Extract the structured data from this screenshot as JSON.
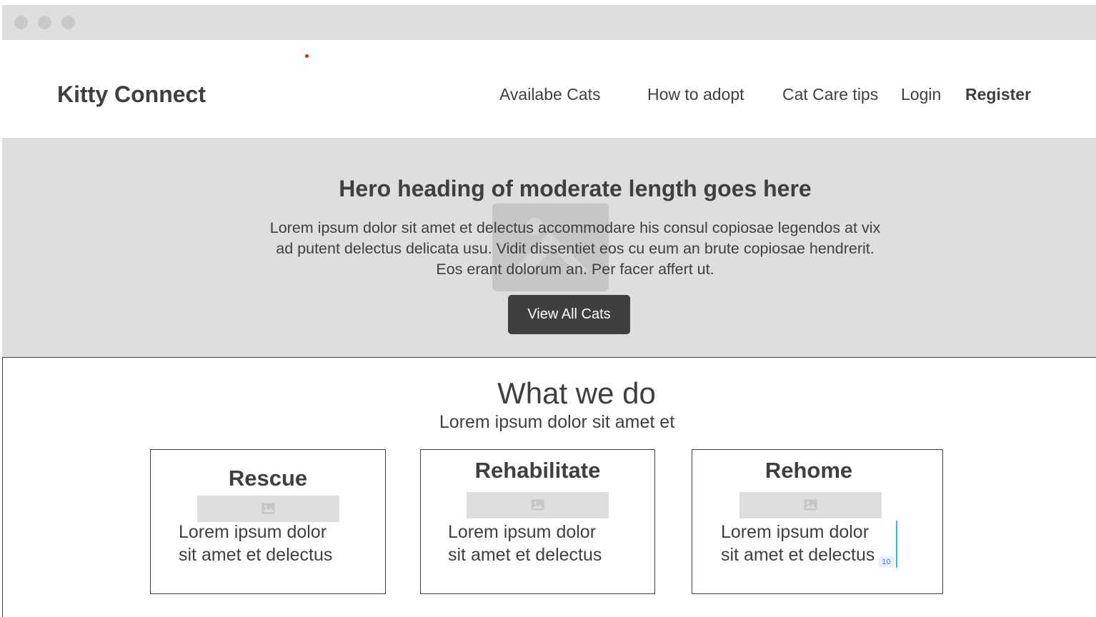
{
  "brand": "Kitty Connect",
  "nav": {
    "available_cats": "Availabe Cats",
    "how_to_adopt": "How to adopt",
    "cat_care_tips": "Cat Care tips",
    "login": "Login",
    "register": "Register"
  },
  "hero": {
    "title": "Hero heading of moderate length goes here",
    "text": "Lorem ipsum dolor sit amet et delectus accommodare his consul copiosae legendos at vix ad putent delectus delicata usu. Vidit dissentiet eos cu eum an brute copiosae hendrerit. Eos erant dolorum an. Per facer affert ut.",
    "button": "View All Cats",
    "image_icon": "image-placeholder-icon"
  },
  "what_we_do": {
    "title": "What we do",
    "subtitle": "Lorem ipsum dolor sit amet et",
    "cards": [
      {
        "title": "Rescue",
        "text_line1": "Lorem ipsum dolor",
        "text_line2": "sit amet et delectus",
        "icon": "image-icon"
      },
      {
        "title": "Rehabilitate",
        "text_line1": "Lorem ipsum dolor",
        "text_line2": "sit amet et delectus",
        "icon": "image-icon"
      },
      {
        "title": "Rehome",
        "text_line1": "Lorem ipsum dolor",
        "text_line2": "sit amet et delectus",
        "icon": "image-icon"
      }
    ]
  },
  "measure_badge": "10",
  "colors": {
    "chrome": "#dedede",
    "text": "#3f3f3f",
    "button_bg": "#3f3f3f",
    "button_text": "#ffffff",
    "hero_bg": "#dedede",
    "marker_red": "#e0241b",
    "cursor_cyan": "#2fb8d8"
  }
}
